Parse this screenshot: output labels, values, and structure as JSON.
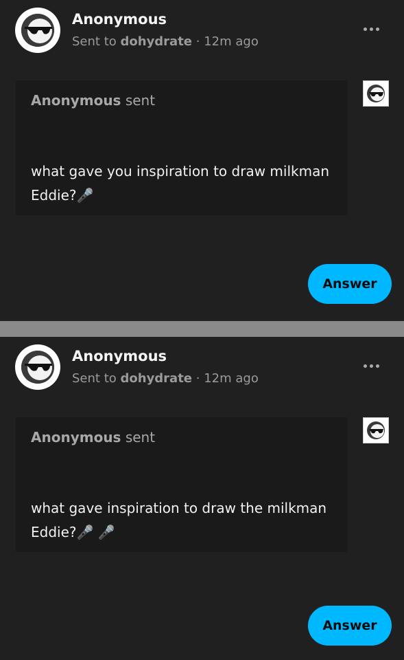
{
  "posts": [
    {
      "author": "Anonymous",
      "sent_to_prefix": "Sent to",
      "recipient": "dohydrate",
      "time": "· 12m ago",
      "sender": "Anonymous",
      "sent_suffix": "sent",
      "question": "what gave you inspiration to draw milkman Eddie?🎤",
      "answer_label": "Answer",
      "avatar_icon": "sunglasses-face-icon",
      "more_icon": "more-options-icon"
    },
    {
      "author": "Anonymous",
      "sent_to_prefix": "Sent to",
      "recipient": "dohydrate",
      "time": "· 12m ago",
      "sender": "Anonymous",
      "sent_suffix": "sent",
      "question": "what gave inspiration to draw the milkman Eddie?🎤 🎤",
      "answer_label": "Answer",
      "avatar_icon": "sunglasses-face-icon",
      "more_icon": "more-options-icon"
    }
  ],
  "colors": {
    "background": "#202020",
    "divider": "#8a8a8a",
    "accent": "#00b8ff"
  }
}
